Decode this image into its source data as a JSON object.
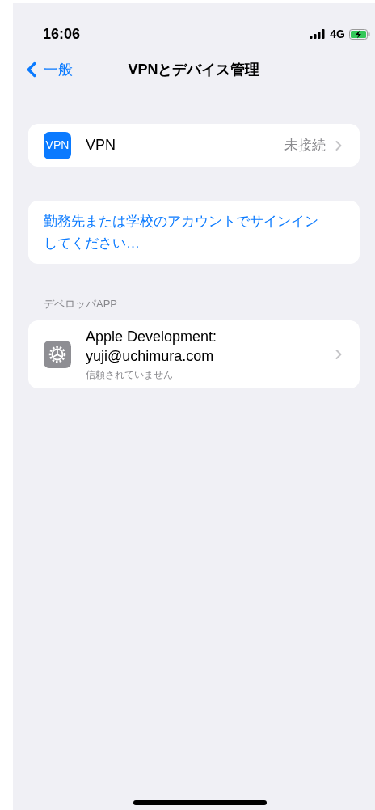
{
  "status_bar": {
    "time": "16:06",
    "network": "4G",
    "charging": true
  },
  "nav": {
    "back": "一般",
    "title": "VPNとデバイス管理"
  },
  "vpn_row": {
    "icon_text": "VPN",
    "label": "VPN",
    "status": "未接続"
  },
  "signin_link": "勤務先または学校のアカウントでサインインしてください…",
  "developer_section": {
    "header": "デベロッパAPP",
    "rows": [
      {
        "title": "Apple Development: yuji@uchimura.com",
        "detail": "信頼されていません"
      }
    ]
  }
}
